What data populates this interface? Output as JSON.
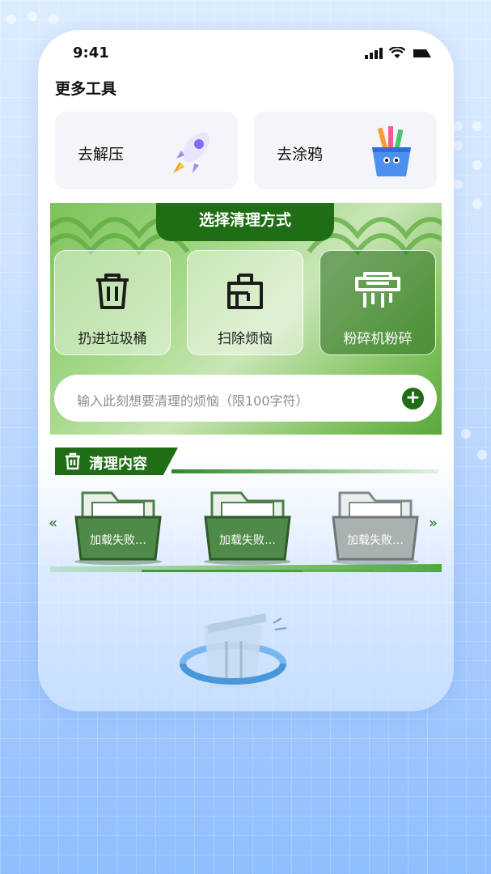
{
  "status_bar": {
    "time": "9:41"
  },
  "more_tools": {
    "title": "更多工具",
    "items": [
      {
        "label": "去解压",
        "icon": "rocket-icon"
      },
      {
        "label": "去涂鸦",
        "icon": "pencil-cup-icon"
      }
    ]
  },
  "clean_panel": {
    "title": "选择清理方式",
    "options": [
      {
        "label": "扔进垃圾桶",
        "icon": "trash-icon",
        "selected": false
      },
      {
        "label": "扫除烦恼",
        "icon": "broom-icon",
        "selected": false
      },
      {
        "label": "粉碎机粉碎",
        "icon": "shredder-icon",
        "selected": true
      }
    ],
    "input_placeholder": "输入此刻想要清理的烦恼（限100字符）",
    "add_icon": "plus-icon"
  },
  "clean_content": {
    "title": "清理内容",
    "items": [
      {
        "label": "加载失败…"
      },
      {
        "label": "加载失败…"
      },
      {
        "label": "加载失败…"
      }
    ]
  },
  "colors": {
    "accent_green": "#1f6d14",
    "bg_blue": "#a9ccff"
  }
}
